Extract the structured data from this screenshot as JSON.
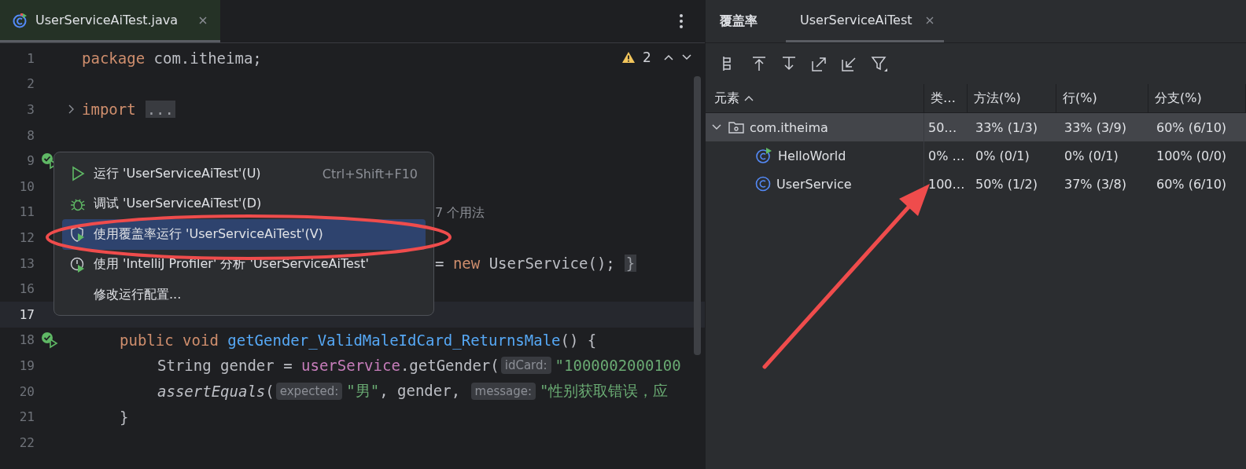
{
  "editor": {
    "tab": {
      "label": "UserServiceAiTest.java",
      "selected": true
    },
    "warnings": "2",
    "lines": [
      {
        "no": "1",
        "kind": "top",
        "current": false,
        "tokens": [
          {
            "kind": "keyword",
            "t": "package"
          },
          {
            "kind": "plain",
            "t": " com.itheima;"
          }
        ]
      },
      {
        "no": "2",
        "kind": "top",
        "current": false
      },
      {
        "no": "3",
        "kind": "top",
        "current": false,
        "gutter": {
          "kind": "fold"
        },
        "tokens": [
          {
            "kind": "keyword",
            "t": "import"
          },
          {
            "kind": "fold",
            "t": "..."
          }
        ]
      },
      {
        "no": "8",
        "kind": "top",
        "current": false
      },
      {
        "no": "9",
        "kind": "top",
        "current": false,
        "gutter": {
          "kind": "run-passed"
        }
      },
      {
        "no": "10",
        "kind": "top",
        "current": false
      },
      {
        "no": "11",
        "kind": "partial",
        "current": false,
        "tokens": [
          {
            "kind": "usage",
            "t": "7 个用法"
          }
        ]
      },
      {
        "no": "12",
        "kind": "top",
        "current": false
      },
      {
        "no": "13",
        "kind": "partial",
        "current": false,
        "tokens": [
          {
            "kind": "plain",
            "t": "= "
          },
          {
            "kind": "keyword",
            "t": "new"
          },
          {
            "kind": "plain",
            "t": " UserService();"
          },
          {
            "kind": "fold",
            "t": "}"
          }
        ]
      },
      {
        "no": "16",
        "kind": "top",
        "current": false
      },
      {
        "no": "17",
        "kind": "member",
        "current": true
      },
      {
        "no": "18",
        "kind": "member",
        "current": false,
        "gutter": {
          "kind": "run-passed"
        },
        "tokens": [
          {
            "kind": "keyword",
            "t": "public void "
          },
          {
            "kind": "method",
            "t": "getGender_ValidMaleIdCard_ReturnsMale"
          },
          {
            "kind": "plain",
            "t": "() {"
          }
        ]
      },
      {
        "no": "19",
        "kind": "body",
        "current": false,
        "tokens": [
          {
            "kind": "plain",
            "t": "String gender = "
          },
          {
            "kind": "field",
            "t": "userService"
          },
          {
            "kind": "plain",
            "t": ".getGender("
          },
          {
            "kind": "hint",
            "t": "idCard:"
          },
          {
            "kind": "string",
            "t": "\"1000002000100"
          }
        ]
      },
      {
        "no": "20",
        "kind": "body",
        "current": false,
        "tokens": [
          {
            "kind": "italic",
            "t": "assertEquals"
          },
          {
            "kind": "plain",
            "t": "("
          },
          {
            "kind": "hint",
            "t": "expected:"
          },
          {
            "kind": "string",
            "t": "\"男\""
          },
          {
            "kind": "plain",
            "t": ", gender, "
          },
          {
            "kind": "hint",
            "t": "message:"
          },
          {
            "kind": "string",
            "t": "\"性别获取错误，应"
          }
        ]
      },
      {
        "no": "21",
        "kind": "member",
        "current": false,
        "tokens": [
          {
            "kind": "plain",
            "t": "}"
          }
        ]
      },
      {
        "no": "22",
        "kind": "top",
        "current": false
      }
    ]
  },
  "menu": {
    "items": [
      {
        "kind": "run",
        "label": "运行 'UserServiceAiTest'(U)",
        "shortcut": "Ctrl+Shift+F10",
        "selected": false
      },
      {
        "kind": "debug",
        "label": "调试 'UserServiceAiTest'(D)",
        "selected": false
      },
      {
        "kind": "coverage",
        "label": "使用覆盖率运行 'UserServiceAiTest'(V)",
        "selected": true
      },
      {
        "kind": "profiler",
        "label": "使用 'IntelliJ Profiler' 分析  'UserServiceAiTest'",
        "selected": false
      },
      {
        "kind": "plain",
        "label": "修改运行配置...",
        "selected": false
      }
    ]
  },
  "coverage": {
    "title": "覆盖率",
    "tabs": [
      {
        "label": "UserServiceAiTest",
        "selected": true
      }
    ],
    "columns": [
      {
        "label": "元素",
        "sorted": true
      },
      {
        "label": "类…",
        "sorted": false
      },
      {
        "label": "方法(%)",
        "sorted": false
      },
      {
        "label": "行(%)",
        "sorted": false
      },
      {
        "label": "分支(%)",
        "sorted": false
      }
    ],
    "rows": [
      {
        "kind": "package",
        "expanded": true,
        "selected": true,
        "cells": [
          "com.itheima",
          "50…",
          "33% (1/3)",
          "33% (3/9)",
          "60% (6/10)"
        ],
        "children": [
          {
            "kind": "runnable-class",
            "selected": false,
            "cells": [
              "HelloWorld",
              "0% …",
              "0% (0/1)",
              "0% (0/1)",
              "100% (0/0)"
            ]
          },
          {
            "kind": "class",
            "selected": false,
            "cells": [
              "UserService",
              "100…",
              "50% (1/2)",
              "37% (3/8)",
              "60% (6/10)"
            ]
          }
        ]
      }
    ]
  }
}
